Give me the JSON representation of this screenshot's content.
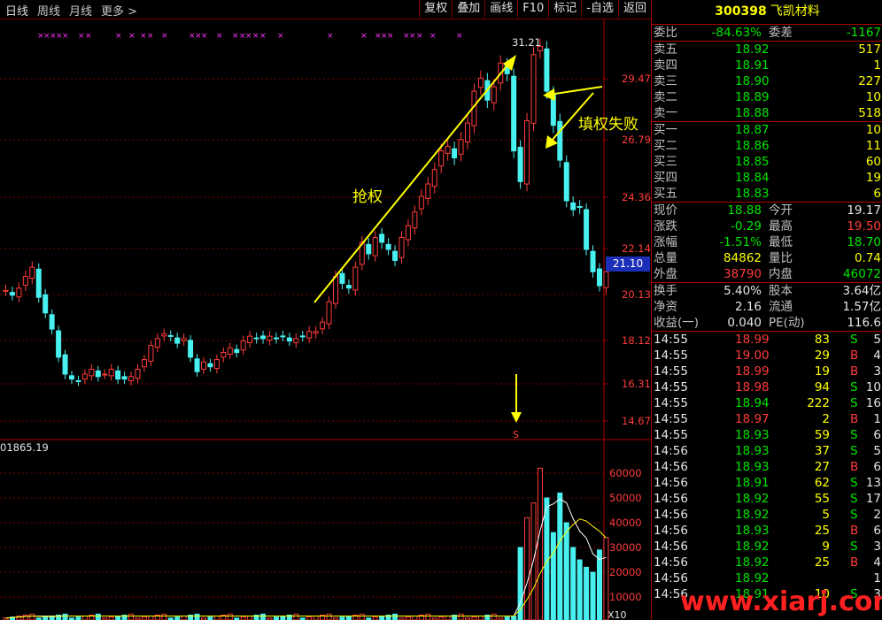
{
  "toolbar": {
    "period_tabs": [
      "日线",
      "周线",
      "月线",
      "更多 >"
    ],
    "buttons": [
      "复权",
      "叠加",
      "画线",
      "F10",
      "标记",
      "-自选",
      "返回"
    ]
  },
  "stock": {
    "code": "300398",
    "name": "飞凯材料"
  },
  "summary": {
    "committee_ratio_label": "委比",
    "committee_ratio": "-84.63%",
    "committee_diff_label": "委差",
    "committee_diff": "-1167"
  },
  "order_book": {
    "asks": [
      {
        "label": "卖五",
        "price": "18.92",
        "qty": "517"
      },
      {
        "label": "卖四",
        "price": "18.91",
        "qty": "1"
      },
      {
        "label": "卖三",
        "price": "18.90",
        "qty": "227"
      },
      {
        "label": "卖二",
        "price": "18.89",
        "qty": "10"
      },
      {
        "label": "卖一",
        "price": "18.88",
        "qty": "518"
      }
    ],
    "bids": [
      {
        "label": "买一",
        "price": "18.87",
        "qty": "10"
      },
      {
        "label": "买二",
        "price": "18.86",
        "qty": "11"
      },
      {
        "label": "买三",
        "price": "18.85",
        "qty": "60"
      },
      {
        "label": "买四",
        "price": "18.84",
        "qty": "19"
      },
      {
        "label": "买五",
        "price": "18.83",
        "qty": "6"
      }
    ]
  },
  "quote": {
    "rows": [
      {
        "l1": "现价",
        "v1": "18.88",
        "c1": "g",
        "l2": "今开",
        "v2": "19.17",
        "c2": "w"
      },
      {
        "l1": "涨跌",
        "v1": "-0.29",
        "c1": "g",
        "l2": "最高",
        "v2": "19.50",
        "c2": "r"
      },
      {
        "l1": "涨幅",
        "v1": "-1.51%",
        "c1": "g",
        "l2": "最低",
        "v2": "18.70",
        "c2": "g"
      },
      {
        "l1": "总量",
        "v1": "84862",
        "c1": "y",
        "l2": "量比",
        "v2": "0.74",
        "c2": "y"
      },
      {
        "l1": "外盘",
        "v1": "38790",
        "c1": "r",
        "l2": "内盘",
        "v2": "46072",
        "c2": "g"
      }
    ],
    "rows2": [
      {
        "l1": "换手",
        "v1": "5.40%",
        "c1": "w",
        "l2": "股本",
        "v2": "3.64亿",
        "c2": "w"
      },
      {
        "l1": "净资",
        "v1": "2.16",
        "c1": "w",
        "l2": "流通",
        "v2": "1.57亿",
        "c2": "w"
      },
      {
        "l1": "收益(一)",
        "v1": "0.040",
        "c1": "w",
        "l2": "PE(动)",
        "v2": "116.6",
        "c2": "w"
      }
    ]
  },
  "ticks": [
    {
      "t": "14:55",
      "p": "18.99",
      "v": "83",
      "d": "S",
      "n": "5"
    },
    {
      "t": "14:55",
      "p": "19.00",
      "v": "29",
      "d": "B",
      "n": "4"
    },
    {
      "t": "14:55",
      "p": "18.99",
      "v": "19",
      "d": "B",
      "n": "3"
    },
    {
      "t": "14:55",
      "p": "18.98",
      "v": "94",
      "d": "S",
      "n": "10"
    },
    {
      "t": "14:55",
      "p": "18.94",
      "v": "222",
      "d": "S",
      "n": "16"
    },
    {
      "t": "14:55",
      "p": "18.97",
      "v": "2",
      "d": "B",
      "n": "1"
    },
    {
      "t": "14:55",
      "p": "18.93",
      "v": "59",
      "d": "S",
      "n": "6"
    },
    {
      "t": "14:56",
      "p": "18.93",
      "v": "37",
      "d": "S",
      "n": "5"
    },
    {
      "t": "14:56",
      "p": "18.93",
      "v": "27",
      "d": "B",
      "n": "6"
    },
    {
      "t": "14:56",
      "p": "18.91",
      "v": "62",
      "d": "S",
      "n": "13"
    },
    {
      "t": "14:56",
      "p": "18.92",
      "v": "55",
      "d": "S",
      "n": "17"
    },
    {
      "t": "14:56",
      "p": "18.92",
      "v": "5",
      "d": "S",
      "n": "2"
    },
    {
      "t": "14:56",
      "p": "18.93",
      "v": "25",
      "d": "B",
      "n": "6"
    },
    {
      "t": "14:56",
      "p": "18.92",
      "v": "9",
      "d": "S",
      "n": "3"
    },
    {
      "t": "14:56",
      "p": "18.92",
      "v": "25",
      "d": "B",
      "n": "4"
    },
    {
      "t": "14:56",
      "p": "18.92",
      "v": "",
      "d": "",
      "n": "1"
    },
    {
      "t": "14:56",
      "p": "18.91",
      "v": "10",
      "d": "S",
      "n": "3"
    }
  ],
  "chart": {
    "price_axis": [
      "29.47",
      "26.79",
      "24.36",
      "22.14",
      "20.13",
      "18.12",
      "16.31",
      "14.67"
    ],
    "current_price_tag": "21.10",
    "peak_label": "31.21",
    "volume_label": "01865.19",
    "volume_axis": [
      "60000",
      "50000",
      "40000",
      "30000",
      "20000",
      "10000"
    ],
    "volume_unit": "X10",
    "marker_s": "S",
    "annotation_grab": "抢权",
    "annotation_fail": "填权失败",
    "colors": {
      "up": "#ff3b3b",
      "down": "#48f0f0",
      "arrow": "#ffff00",
      "grid": "#800000"
    }
  },
  "watermark": "www.xiarj.com"
}
